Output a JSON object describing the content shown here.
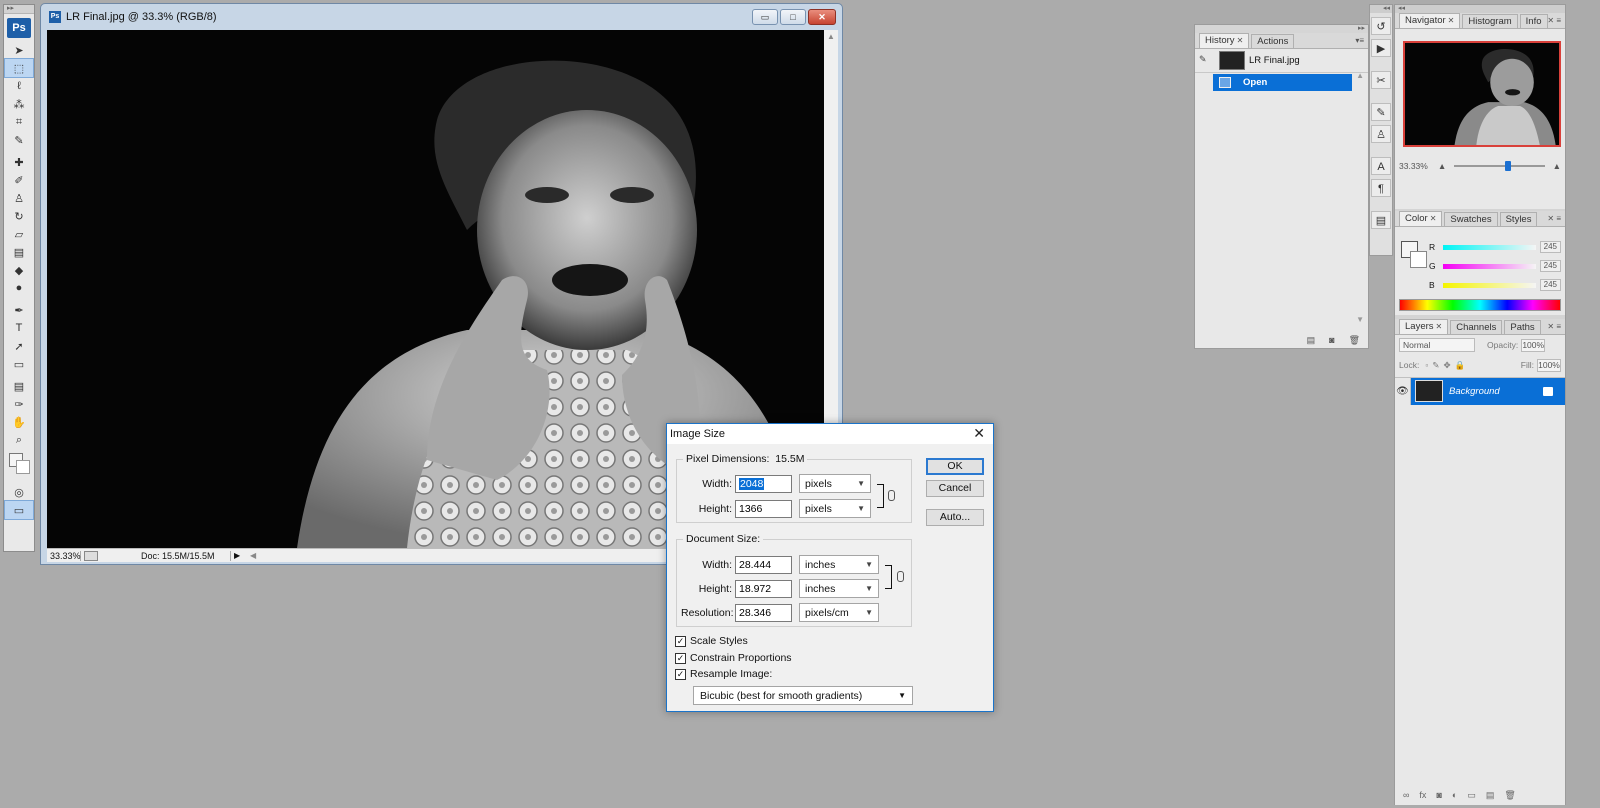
{
  "app": {
    "logo": "Ps"
  },
  "tools": [
    {
      "name": "move-tool-icon",
      "glyph": "➤"
    },
    {
      "name": "marquee-tool-icon",
      "glyph": "⬚",
      "selected": true
    },
    {
      "name": "lasso-tool-icon",
      "glyph": "ℓ"
    },
    {
      "name": "magic-wand-tool-icon",
      "glyph": "⁂"
    },
    {
      "name": "crop-tool-icon",
      "glyph": "⌗"
    },
    {
      "name": "slice-tool-icon",
      "glyph": "✎"
    },
    {
      "name": "healing-brush-tool-icon",
      "glyph": "✚"
    },
    {
      "name": "brush-tool-icon",
      "glyph": "✐"
    },
    {
      "name": "clone-stamp-tool-icon",
      "glyph": "♙"
    },
    {
      "name": "history-brush-tool-icon",
      "glyph": "↻"
    },
    {
      "name": "eraser-tool-icon",
      "glyph": "▱"
    },
    {
      "name": "gradient-tool-icon",
      "glyph": "▤"
    },
    {
      "name": "blur-tool-icon",
      "glyph": "◆"
    },
    {
      "name": "dodge-tool-icon",
      "glyph": "●"
    },
    {
      "name": "pen-tool-icon",
      "glyph": "✒"
    },
    {
      "name": "type-tool-icon",
      "glyph": "T"
    },
    {
      "name": "path-selection-tool-icon",
      "glyph": "➚"
    },
    {
      "name": "shape-tool-icon",
      "glyph": "▭"
    },
    {
      "name": "notes-tool-icon",
      "glyph": "▤"
    },
    {
      "name": "eyedropper-tool-icon",
      "glyph": "✑"
    },
    {
      "name": "hand-tool-icon",
      "glyph": "✋"
    },
    {
      "name": "zoom-tool-icon",
      "glyph": "⌕"
    }
  ],
  "document": {
    "title": "LR Final.jpg @ 33.3% (RGB/8)",
    "doc_icon": "Ps",
    "zoom": "33.33%",
    "doc_size": "Doc: 15.5M/15.5M",
    "window_buttons": {
      "minimize": "▭",
      "maximize": "□",
      "close": "✕"
    }
  },
  "history": {
    "tabs": [
      {
        "label": "History",
        "active": true
      },
      {
        "label": "Actions",
        "active": false
      }
    ],
    "snapshot": "LR Final.jpg",
    "state": "Open"
  },
  "navigator": {
    "tabs": [
      {
        "label": "Navigator",
        "active": true
      },
      {
        "label": "Histogram",
        "active": false
      },
      {
        "label": "Info",
        "active": false
      }
    ],
    "zoom": "33.33%",
    "zoom_slider_fraction": 0.56
  },
  "color": {
    "tabs": [
      {
        "label": "Color",
        "active": true
      },
      {
        "label": "Swatches",
        "active": false
      },
      {
        "label": "Styles",
        "active": false
      }
    ],
    "channels": [
      {
        "label": "R",
        "value": "245",
        "gradient": "linear-gradient(90deg,#00f5f5,#f5f5f5)"
      },
      {
        "label": "G",
        "value": "245",
        "gradient": "linear-gradient(90deg,#f500f5,#f5f5f5)"
      },
      {
        "label": "B",
        "value": "245",
        "gradient": "linear-gradient(90deg,#f5f500,#f5f5f5)"
      }
    ]
  },
  "layers": {
    "tabs": [
      {
        "label": "Layers",
        "active": true
      },
      {
        "label": "Channels",
        "active": false
      },
      {
        "label": "Paths",
        "active": false
      }
    ],
    "blend_mode": "Normal",
    "opacity_label": "Opacity:",
    "opacity": "100%",
    "lock_label": "Lock:",
    "fill_label": "Fill:",
    "fill": "100%",
    "layer_name": "Background"
  },
  "dialog": {
    "title": "Image Size",
    "pixel_dimensions_label": "Pixel Dimensions:",
    "pixel_dimensions_value": "15.5M",
    "px_width_label": "Width:",
    "px_width": "2048",
    "px_height_label": "Height:",
    "px_height": "1366",
    "px_unit": "pixels",
    "document_size_label": "Document Size:",
    "doc_width_label": "Width:",
    "doc_width": "28.444",
    "doc_width_unit": "inches",
    "doc_height_label": "Height:",
    "doc_height": "18.972",
    "doc_height_unit": "inches",
    "resolution_label": "Resolution:",
    "resolution": "28.346",
    "resolution_unit": "pixels/cm",
    "ok": "OK",
    "cancel": "Cancel",
    "auto": "Auto...",
    "scale_styles": "Scale Styles",
    "constrain": "Constrain Proportions",
    "resample": "Resample Image:",
    "resample_method": "Bicubic (best for smooth gradients)"
  }
}
